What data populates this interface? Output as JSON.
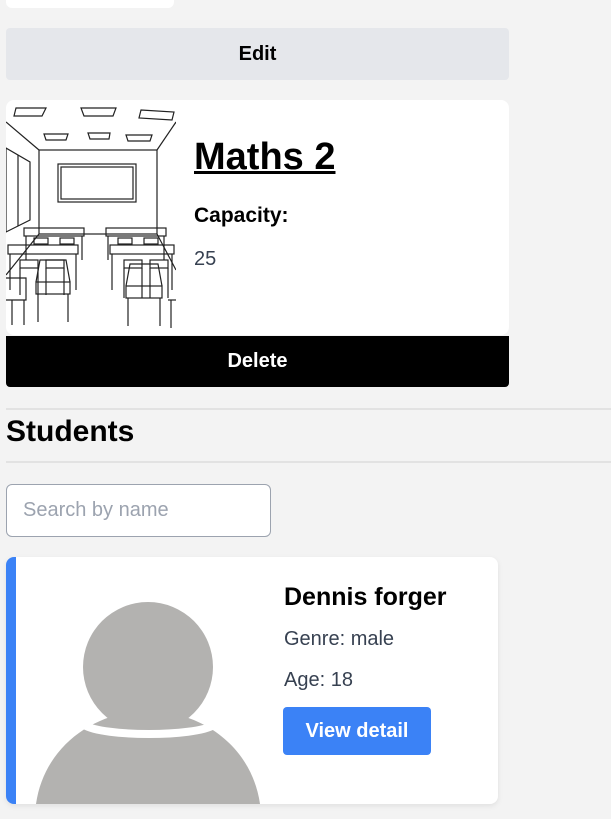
{
  "classroom": {
    "edit_label": "Edit",
    "title": "Maths 2",
    "capacity_label": "Capacity:",
    "capacity_value": "25",
    "delete_label": "Delete"
  },
  "students": {
    "heading": "Students",
    "search_placeholder": "Search by name",
    "items": [
      {
        "name": "Dennis forger",
        "genre": "Genre: male",
        "age": "Age: 18",
        "view_label": "View detail"
      }
    ]
  },
  "colors": {
    "background": "#f3f3f3",
    "edit_button": "#e5e7eb",
    "delete_button": "#000000",
    "accent_blue": "#3b82f6",
    "avatar_gray": "#b3b2b0"
  },
  "icons": {
    "classroom_image": "classroom-illustration",
    "student_avatar": "user-avatar-icon"
  }
}
